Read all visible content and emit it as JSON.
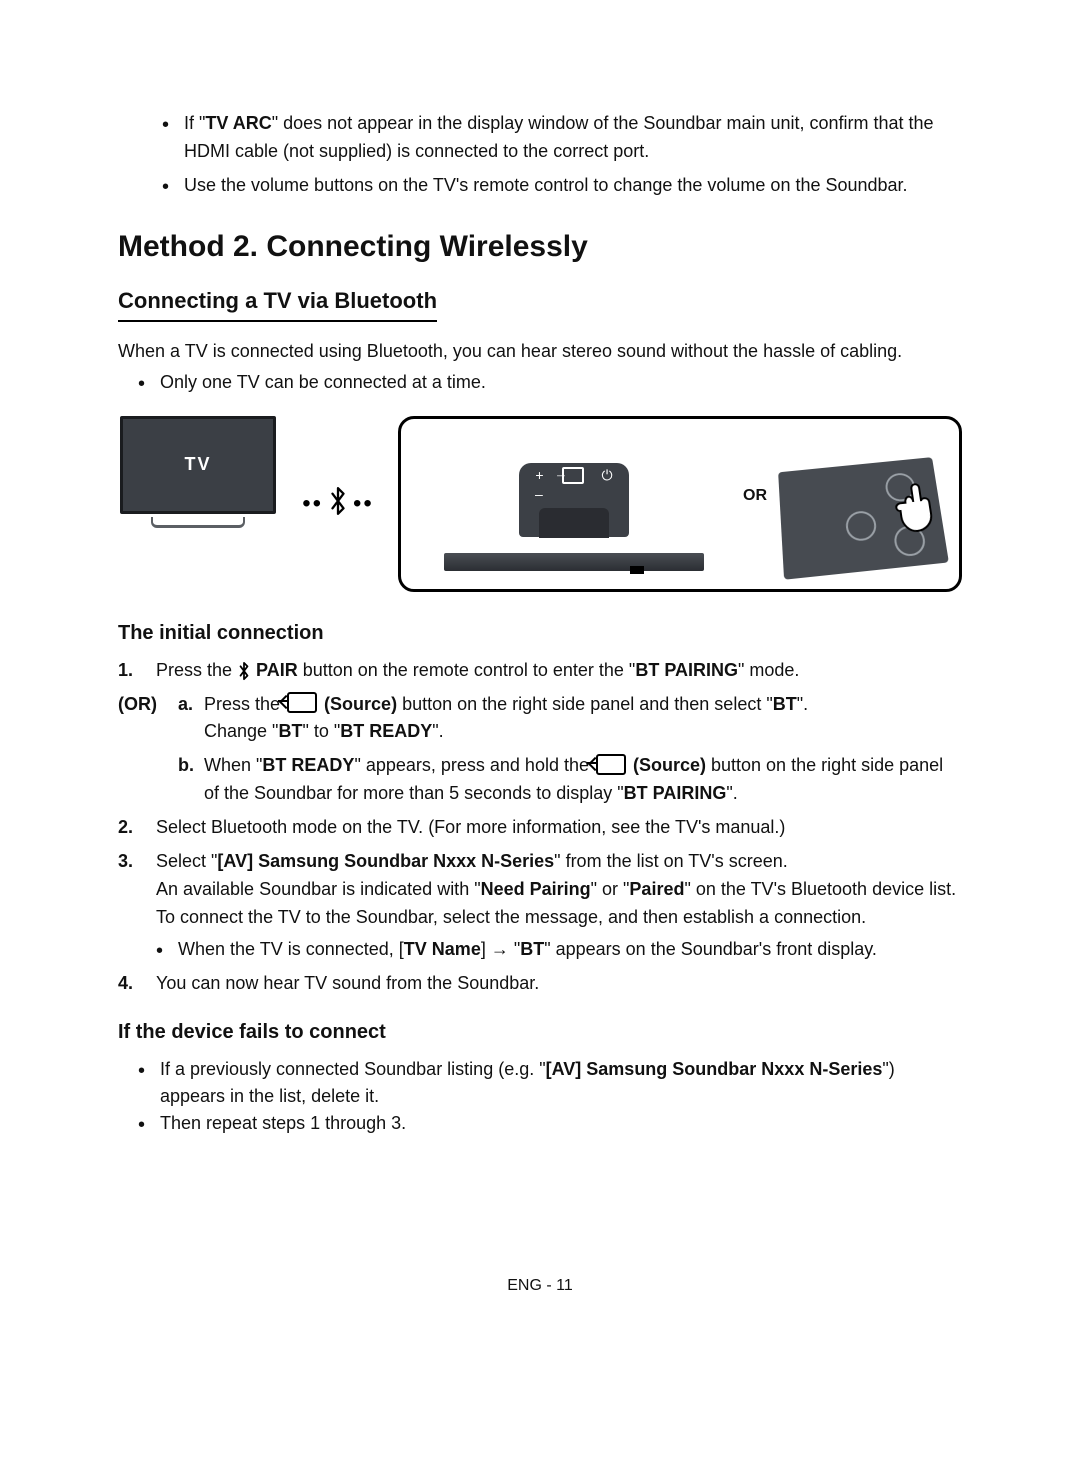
{
  "top_notes": {
    "b1_pre": "If \"",
    "b1_bold": "TV ARC",
    "b1_post": "\" does not appear in the display window of the Soundbar main unit, confirm that the HDMI cable (not supplied) is connected to the correct port.",
    "b2": "Use the volume buttons on the TV's remote control to change the volume on the Soundbar."
  },
  "headings": {
    "method": "Method 2. Connecting Wirelessly",
    "sub": "Connecting a TV via Bluetooth",
    "initial": "The initial connection",
    "fails": "If the device fails to connect"
  },
  "intro": {
    "line": "When a TV is connected using Bluetooth, you can hear stereo sound without the hassle of cabling.",
    "bullet": "Only one TV can be connected at a time."
  },
  "diagram": {
    "tv_label": "TV",
    "or_label": "OR"
  },
  "steps": {
    "s1_num": "1.",
    "s1_pre": "Press the ",
    "s1_pair": " PAIR",
    "s1_mid": " button on the remote control to enter the \"",
    "s1_bold": "BT PAIRING",
    "s1_post": "\" mode.",
    "or_tag": "(OR)",
    "sa_letter": "a.",
    "sa_pre": "Press the ",
    "sa_source": " (Source)",
    "sa_mid": " button on the right side panel and then select \"",
    "sa_bt": "BT",
    "sa_post": "\".",
    "sa_line2_pre": "Change \"",
    "sa_line2_bt": "BT",
    "sa_line2_mid": "\" to \"",
    "sa_line2_ready": "BT READY",
    "sa_line2_post": "\".",
    "sb_letter": "b.",
    "sb_pre": "When \"",
    "sb_ready": "BT READY",
    "sb_mid1": "\" appears, press and hold the ",
    "sb_source": " (Source)",
    "sb_mid2": " button on the right side panel of the Soundbar for more than 5 seconds to display \"",
    "sb_pairing": "BT PAIRING",
    "sb_post": "\".",
    "s2_num": "2.",
    "s2": "Select Bluetooth mode on the TV. (For more information, see the TV's manual.)",
    "s3_num": "3.",
    "s3_pre": "Select \"",
    "s3_bold": "[AV] Samsung Soundbar Nxxx N-Series",
    "s3_mid": "\" from the list on TV's screen.",
    "s3_line2_pre": "An available Soundbar is indicated with \"",
    "s3_line2_np": "Need Pairing",
    "s3_line2_mid": "\" or \"",
    "s3_line2_paired": "Paired",
    "s3_line2_post": "\" on the TV's Bluetooth device list. To connect the TV to the Soundbar, select the message, and then establish a connection.",
    "s3_bullet_pre": "When the TV is connected, [",
    "s3_bullet_tvname": "TV Name",
    "s3_bullet_mid": "] → \"",
    "s3_bullet_bt": "BT",
    "s3_bullet_post": "\" appears on the Soundbar's front display.",
    "s4_num": "4.",
    "s4": "You can now hear TV sound from the Soundbar."
  },
  "fails": {
    "b1_pre": "If a previously connected Soundbar listing (e.g. \"",
    "b1_bold": "[AV] Samsung Soundbar Nxxx N-Series",
    "b1_post": "\") appears in the list, delete it.",
    "b2": "Then repeat steps 1 through 3."
  },
  "footer": "ENG - 11"
}
